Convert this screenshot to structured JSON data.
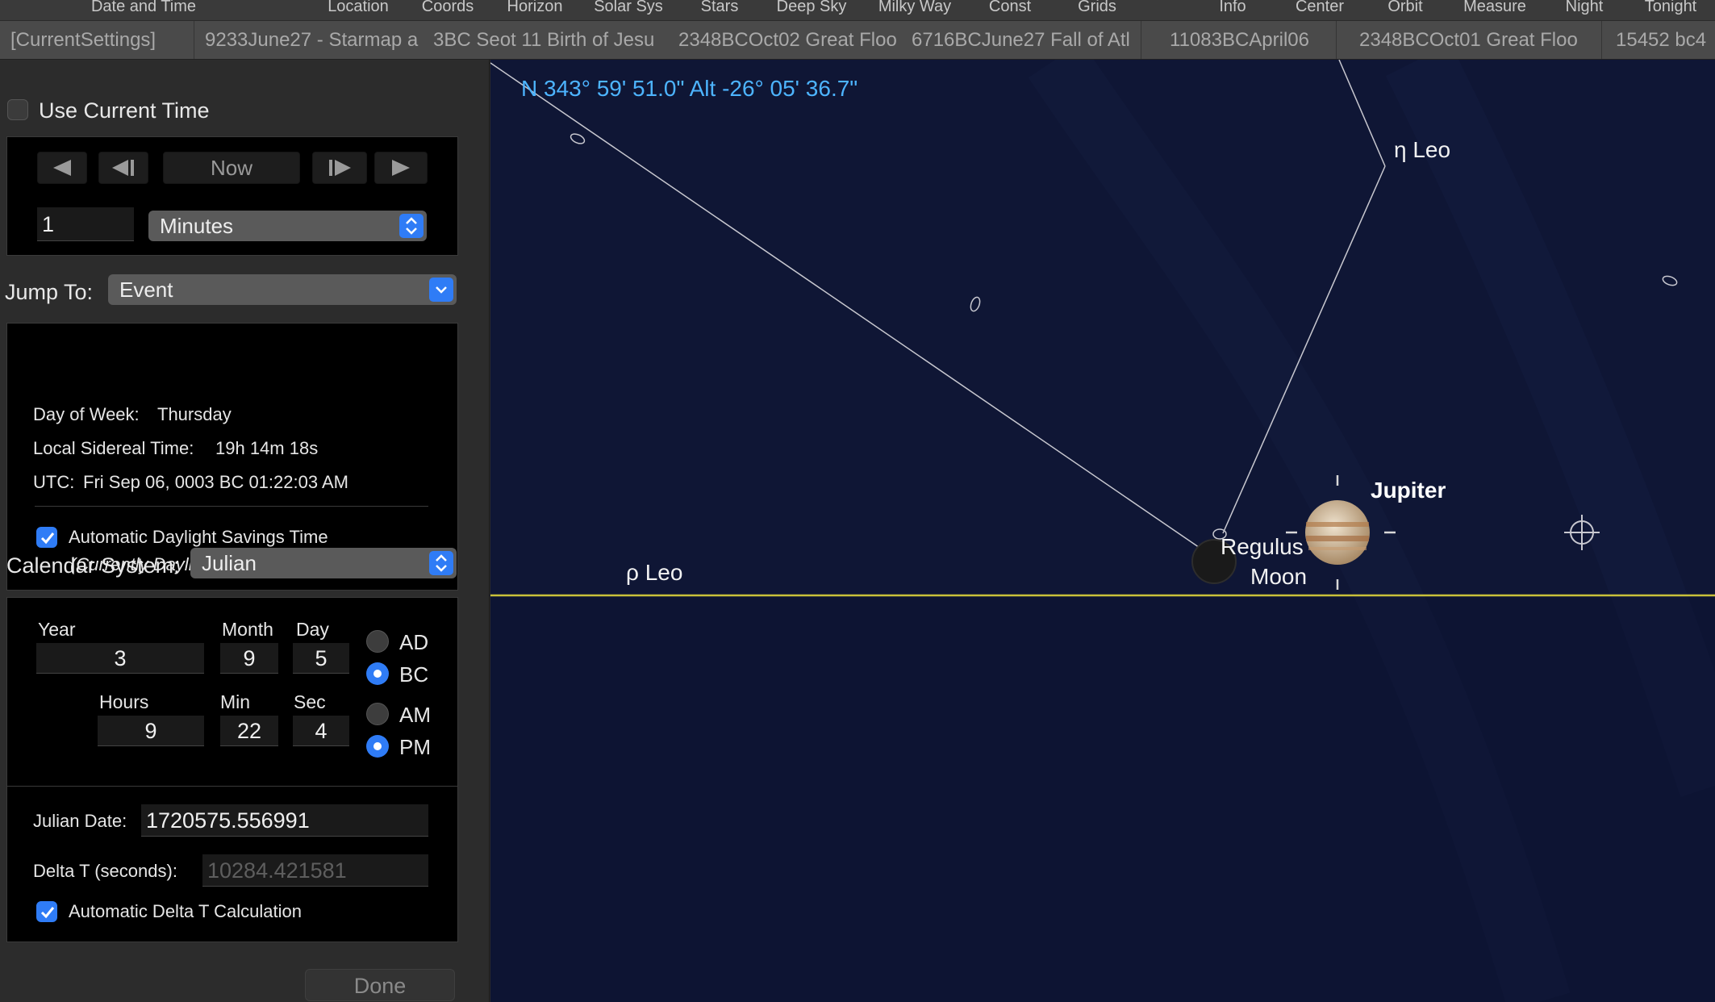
{
  "toolbar": {
    "items": [
      "Date and Time",
      "Location",
      "Coords",
      "Horizon",
      "Solar Sys",
      "Stars",
      "Deep Sky",
      "Milky Way",
      "Const",
      "Grids",
      "Info",
      "Center",
      "Orbit",
      "Measure",
      "Night",
      "Tonight"
    ]
  },
  "bookmarks": {
    "items": [
      "[CurrentSettings]",
      "9233June27 - Starmap a",
      "3BC Seot 11 Birth of Jesu",
      "2348BCOct02 Great Floo",
      "6716BCJune27 Fall of Atl",
      "11083BCApril06",
      "2348BCOct01 Great Floo",
      "15452 bc4"
    ]
  },
  "panel": {
    "use_current_time_label": "Use Current Time",
    "nav": {
      "now_label": "Now"
    },
    "step_value": "1",
    "step_unit": "Minutes",
    "jump_to_label": "Jump To:",
    "jump_to_value": "Event",
    "info": {
      "day_of_week_label": "Day of Week:",
      "day_of_week_value": "Thursday",
      "lst_label": "Local Sidereal Time:",
      "lst_value": "19h 14m 18s",
      "utc_label": "UTC:",
      "utc_value": "Fri Sep 06, 0003 BC 01:22:03 AM",
      "dst_label": "Automatic Daylight Savings Time",
      "dst_note": "(Currently Daylight Savings Time)"
    },
    "calendar_label": "Calendar System:",
    "calendar_value": "Julian",
    "date": {
      "year_label": "Year",
      "year_value": "3",
      "month_label": "Month",
      "month_value": "9",
      "day_label": "Day",
      "day_value": "5",
      "hours_label": "Hours",
      "hours_value": "9",
      "min_label": "Min",
      "min_value": "22",
      "sec_label": "Sec",
      "sec_value": "4",
      "ad_label": "AD",
      "bc_label": "BC",
      "am_label": "AM",
      "pm_label": "PM"
    },
    "julian": {
      "jd_label": "Julian Date:",
      "jd_value": "1720575.556991",
      "deltat_label": "Delta T (seconds):",
      "deltat_value": "10284.421581",
      "auto_deltat_label": "Automatic Delta T Calculation"
    },
    "done_label": "Done"
  },
  "sky": {
    "coords": "N 343° 59' 51.0\" Alt -26° 05' 36.7\"",
    "labels": {
      "eta_leo": "η Leo",
      "rho_leo": "ρ Leo",
      "jupiter": "Jupiter",
      "regulus": "Regulus",
      "moon": "Moon"
    },
    "colors": {
      "background": "#0f1635",
      "horizon": "#c9c13a",
      "coords_text": "#4db4ff",
      "lines": "#c8c8d0"
    }
  }
}
